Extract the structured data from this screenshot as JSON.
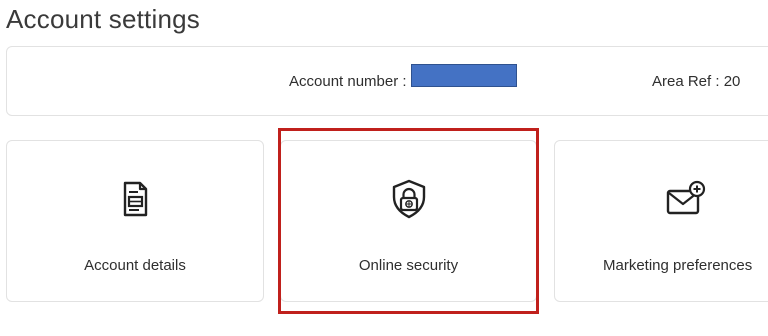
{
  "page": {
    "title": "Account settings"
  },
  "account_bar": {
    "account_number_label": "Account number :",
    "account_number_value": "",
    "area_ref": "Area Ref : 20"
  },
  "cards": [
    {
      "label": "Account details",
      "icon": "document-icon"
    },
    {
      "label": "Online security",
      "icon": "shield-lock-icon"
    },
    {
      "label": "Marketing preferences",
      "icon": "envelope-plus-icon"
    }
  ],
  "highlight": {
    "target": "Online security",
    "color": "#c0201c"
  },
  "colors": {
    "redaction": "#4472c4",
    "border": "#e2e2e2",
    "text": "#2f2f2f"
  }
}
